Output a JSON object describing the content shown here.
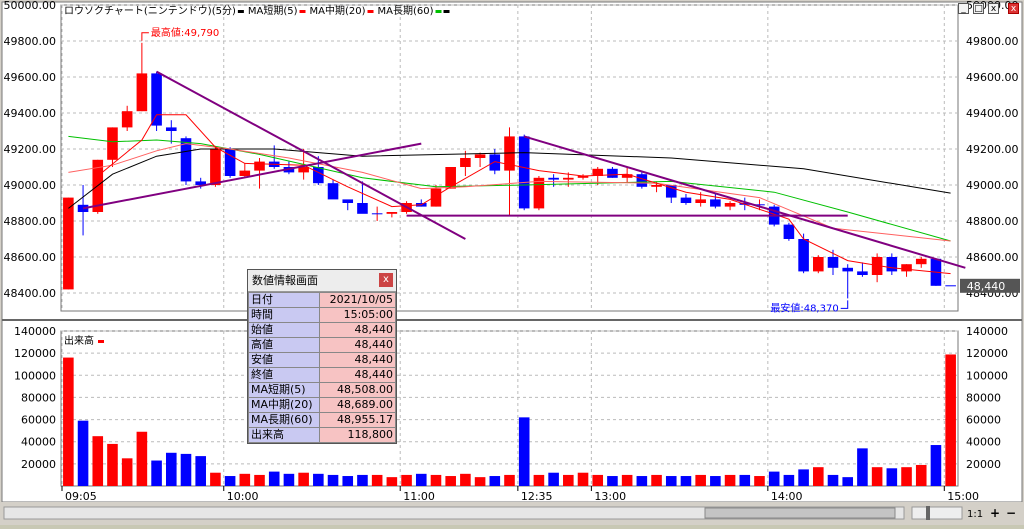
{
  "chart_data": [
    {
      "type": "candlestick",
      "legend": [
        {
          "label": "ロウソクチャート(ニンテンドウ)(5分)",
          "color": "#000000"
        },
        {
          "label": "MA短期(5)",
          "color": "#ff0000"
        },
        {
          "label": "MA中期(20)",
          "color": "#ff0000"
        },
        {
          "label": "MA長期(60)",
          "color": "#00c000"
        }
      ],
      "tail_swatch_color": "#000000",
      "ylim": [
        48300,
        50000
      ],
      "yticks": [
        "50000.00",
        "49800.00",
        "49600.00",
        "49400.00",
        "49200.00",
        "49000.00",
        "48800.00",
        "48600.00",
        "48400.00"
      ],
      "ytick_values": [
        50000,
        49800,
        49600,
        49400,
        49200,
        49000,
        48800,
        48600,
        48400
      ],
      "xticks": [
        {
          "label": "09:05",
          "i": 0
        },
        {
          "label": "10:00",
          "i": 11
        },
        {
          "label": "11:00",
          "i": 23
        },
        {
          "label": "12:35",
          "i": 31
        },
        {
          "label": "13:00",
          "i": 36
        },
        {
          "label": "14:00",
          "i": 48
        },
        {
          "label": "15:00",
          "i": 60
        }
      ],
      "up_color": "#ff0000",
      "down_color": "#0000ff",
      "candles": [
        [
          48420,
          48930,
          48420,
          48930
        ],
        [
          48890,
          49000,
          48720,
          48850
        ],
        [
          48850,
          49140,
          48840,
          49140
        ],
        [
          49140,
          49320,
          49100,
          49320
        ],
        [
          49320,
          49440,
          49300,
          49410
        ],
        [
          49410,
          49790,
          49410,
          49620
        ],
        [
          49620,
          49630,
          49300,
          49330
        ],
        [
          49320,
          49360,
          49230,
          49300
        ],
        [
          49260,
          49270,
          49000,
          49020
        ],
        [
          49020,
          49040,
          48980,
          49000
        ],
        [
          49000,
          49210,
          48990,
          49200
        ],
        [
          49200,
          49210,
          49040,
          49050
        ],
        [
          49050,
          49120,
          49040,
          49080
        ],
        [
          49080,
          49150,
          48980,
          49130
        ],
        [
          49130,
          49220,
          49090,
          49100
        ],
        [
          49100,
          49130,
          49060,
          49070
        ],
        [
          49070,
          49200,
          49030,
          49100
        ],
        [
          49100,
          49160,
          49000,
          49010
        ],
        [
          49010,
          49030,
          48940,
          48920
        ],
        [
          48920,
          48910,
          48860,
          48900
        ],
        [
          48900,
          49020,
          48860,
          48840
        ],
        [
          48840,
          48880,
          48800,
          48840
        ],
        [
          48840,
          48850,
          48820,
          48850
        ],
        [
          48850,
          48910,
          48840,
          48900
        ],
        [
          48900,
          48920,
          48880,
          48880
        ],
        [
          48880,
          49000,
          48880,
          48980
        ],
        [
          48980,
          49100,
          48980,
          49100
        ],
        [
          49100,
          49190,
          49050,
          49150
        ],
        [
          49150,
          49180,
          49100,
          49170
        ],
        [
          49170,
          49200,
          49060,
          49080
        ],
        [
          49080,
          49320,
          48830,
          49270
        ],
        [
          49270,
          49280,
          48860,
          48870
        ],
        [
          48870,
          49050,
          48860,
          49040
        ],
        [
          49040,
          49060,
          48990,
          49030
        ],
        [
          49030,
          49070,
          48990,
          49040
        ],
        [
          49040,
          49060,
          49030,
          49050
        ],
        [
          49050,
          49100,
          49000,
          49090
        ],
        [
          49090,
          49100,
          49040,
          49040
        ],
        [
          49040,
          49100,
          49010,
          49060
        ],
        [
          49060,
          49070,
          48980,
          48990
        ],
        [
          48990,
          49020,
          48960,
          49000
        ],
        [
          49000,
          49000,
          48900,
          48930
        ],
        [
          48930,
          48950,
          48890,
          48900
        ],
        [
          48900,
          48960,
          48880,
          48920
        ],
        [
          48920,
          48950,
          48870,
          48880
        ],
        [
          48880,
          48910,
          48860,
          48900
        ],
        [
          48900,
          48930,
          48860,
          48890
        ],
        [
          48890,
          48920,
          48860,
          48890
        ],
        [
          48880,
          48890,
          48770,
          48780
        ],
        [
          48780,
          48790,
          48690,
          48700
        ],
        [
          48700,
          48730,
          48510,
          48520
        ],
        [
          48520,
          48610,
          48510,
          48600
        ],
        [
          48600,
          48640,
          48500,
          48540
        ],
        [
          48540,
          48560,
          48370,
          48520
        ],
        [
          48520,
          48570,
          48490,
          48500
        ],
        [
          48500,
          48620,
          48460,
          48600
        ],
        [
          48600,
          48620,
          48500,
          48520
        ],
        [
          48520,
          48560,
          48490,
          48560
        ],
        [
          48560,
          48600,
          48540,
          48590
        ],
        [
          48590,
          48590,
          48440,
          48440
        ],
        [
          48440,
          48440,
          48440,
          48440
        ]
      ],
      "ma_short": [
        [
          2,
          49050
        ],
        [
          5,
          49250
        ],
        [
          6,
          49390
        ],
        [
          8,
          49390
        ],
        [
          10,
          49210
        ],
        [
          12,
          49120
        ],
        [
          16,
          49110
        ],
        [
          19,
          48990
        ],
        [
          22,
          48880
        ],
        [
          24,
          48890
        ],
        [
          26,
          48990
        ],
        [
          29,
          49130
        ],
        [
          32,
          49080
        ],
        [
          35,
          49050
        ],
        [
          38,
          49060
        ],
        [
          42,
          48960
        ],
        [
          45,
          48920
        ],
        [
          49,
          48810
        ],
        [
          50,
          48700
        ],
        [
          53,
          48580
        ],
        [
          56,
          48540
        ],
        [
          60,
          48508
        ]
      ],
      "ma_mid": [
        [
          0,
          49070
        ],
        [
          3,
          49110
        ],
        [
          6,
          49190
        ],
        [
          8,
          49230
        ],
        [
          11,
          49200
        ],
        [
          15,
          49150
        ],
        [
          20,
          49070
        ],
        [
          24,
          48980
        ],
        [
          27,
          48990
        ],
        [
          32,
          49020
        ],
        [
          40,
          49010
        ],
        [
          47,
          48930
        ],
        [
          52,
          48760
        ],
        [
          60,
          48689
        ]
      ],
      "ma_long": [
        [
          0,
          49270
        ],
        [
          3,
          49240
        ],
        [
          6,
          49250
        ],
        [
          9,
          49230
        ],
        [
          13,
          49170
        ],
        [
          20,
          49040
        ],
        [
          25,
          48990
        ],
        [
          31,
          49000
        ],
        [
          41,
          49020
        ],
        [
          48,
          48960
        ],
        [
          53,
          48850
        ],
        [
          60,
          48689
        ]
      ],
      "ma_tail": [
        [
          0,
          48870
        ],
        [
          3,
          49060
        ],
        [
          6,
          49160
        ],
        [
          9,
          49200
        ],
        [
          14,
          49200
        ],
        [
          20,
          49160
        ],
        [
          31,
          49180
        ],
        [
          41,
          49150
        ],
        [
          50,
          49090
        ],
        [
          60,
          48955.17
        ]
      ],
      "annotations": {
        "high": {
          "label": "最高値:49,790",
          "i": 5,
          "value": 49790
        },
        "low": {
          "label": "最安値:48,370",
          "i": 53,
          "value": 48370
        }
      },
      "last_price": "48,440",
      "trendlines": [
        [
          [
            1,
            48870
          ],
          [
            24,
            49230
          ]
        ],
        [
          [
            6,
            49630
          ],
          [
            27,
            48700
          ]
        ],
        [
          [
            23,
            48830
          ],
          [
            53,
            48830
          ]
        ],
        [
          [
            31,
            49270
          ],
          [
            61,
            48540
          ]
        ]
      ]
    },
    {
      "type": "bar",
      "title": "出来高",
      "title_marker_color": "#ff0000",
      "ylim": [
        0,
        140000
      ],
      "yticks": [
        "140000",
        "120000",
        "100000",
        "80000",
        "60000",
        "40000",
        "20000"
      ],
      "ytick_values": [
        140000,
        120000,
        100000,
        80000,
        60000,
        40000,
        20000
      ],
      "values": [
        116000,
        59000,
        45000,
        38000,
        25000,
        49000,
        23000,
        30000,
        29000,
        27000,
        12000,
        9000,
        11000,
        10000,
        13000,
        11000,
        12000,
        11000,
        10000,
        9000,
        10000,
        10000,
        8000,
        10000,
        11000,
        10000,
        9000,
        11000,
        8000,
        9000,
        10000,
        62000,
        10000,
        12000,
        10000,
        12000,
        10000,
        9000,
        10000,
        9000,
        10000,
        9000,
        9000,
        10000,
        9000,
        10000,
        10000,
        9000,
        13000,
        10000,
        15000,
        17000,
        10000,
        8000,
        34000,
        17000,
        16000,
        17000,
        19000,
        37000,
        118800
      ],
      "colors": "up_down"
    }
  ],
  "info_panel": {
    "title": "数値情報画面",
    "close": "x",
    "rows": [
      {
        "k": "日付",
        "v": "2021/10/05"
      },
      {
        "k": "時間",
        "v": "15:05:00"
      },
      {
        "k": "始値",
        "v": "48,440"
      },
      {
        "k": "高値",
        "v": "48,440"
      },
      {
        "k": "安値",
        "v": "48,440"
      },
      {
        "k": "終値",
        "v": "48,440"
      },
      {
        "k": "MA短期(5)",
        "v": "48,508.00"
      },
      {
        "k": "MA中期(20)",
        "v": "48,689.00"
      },
      {
        "k": "MA長期(60)",
        "v": "48,955.17"
      },
      {
        "k": "出来高",
        "v": "118,800"
      }
    ]
  },
  "window_buttons": {
    "minimize": "_",
    "restore": "□",
    "close": "x",
    "chart_close": "x"
  },
  "zoom_label": "1:1",
  "zoom_plus": "+",
  "zoom_minus": "−"
}
